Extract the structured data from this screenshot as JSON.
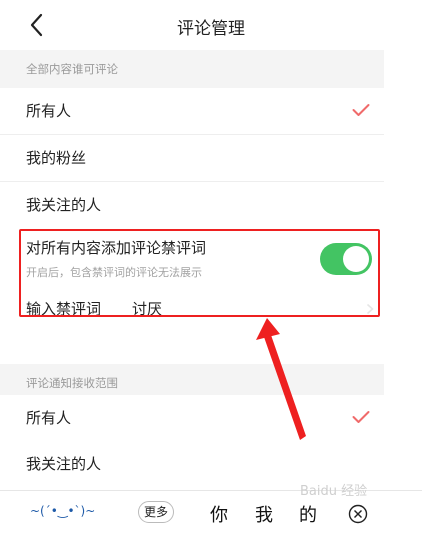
{
  "header": {
    "title": "评论管理"
  },
  "comment_permission": {
    "section_label": "全部内容谁可评论",
    "options": [
      {
        "label": "所有人",
        "selected": true
      },
      {
        "label": "我的粉丝",
        "selected": false
      },
      {
        "label": "我关注的人",
        "selected": false
      }
    ]
  },
  "ban_words": {
    "title": "对所有内容添加评论禁评词",
    "subtitle": "开启后，包含禁评词的评论无法展示",
    "enabled": true,
    "input_label": "输入禁评词",
    "input_value": "讨厌"
  },
  "notify_scope": {
    "section_label": "评论通知接收范围",
    "options": [
      {
        "label": "所有人",
        "selected": true
      },
      {
        "label": "我关注的人",
        "selected": false
      }
    ]
  },
  "keyboard": {
    "emoticon": "~(´•‿•`)~",
    "more_label": "更多",
    "candidates": [
      "你",
      "我",
      "的"
    ]
  },
  "colors": {
    "accent_check": "#f06a6a",
    "toggle_on": "#43c463",
    "highlight": "#ee2020"
  },
  "watermark": "Baidu 经验"
}
